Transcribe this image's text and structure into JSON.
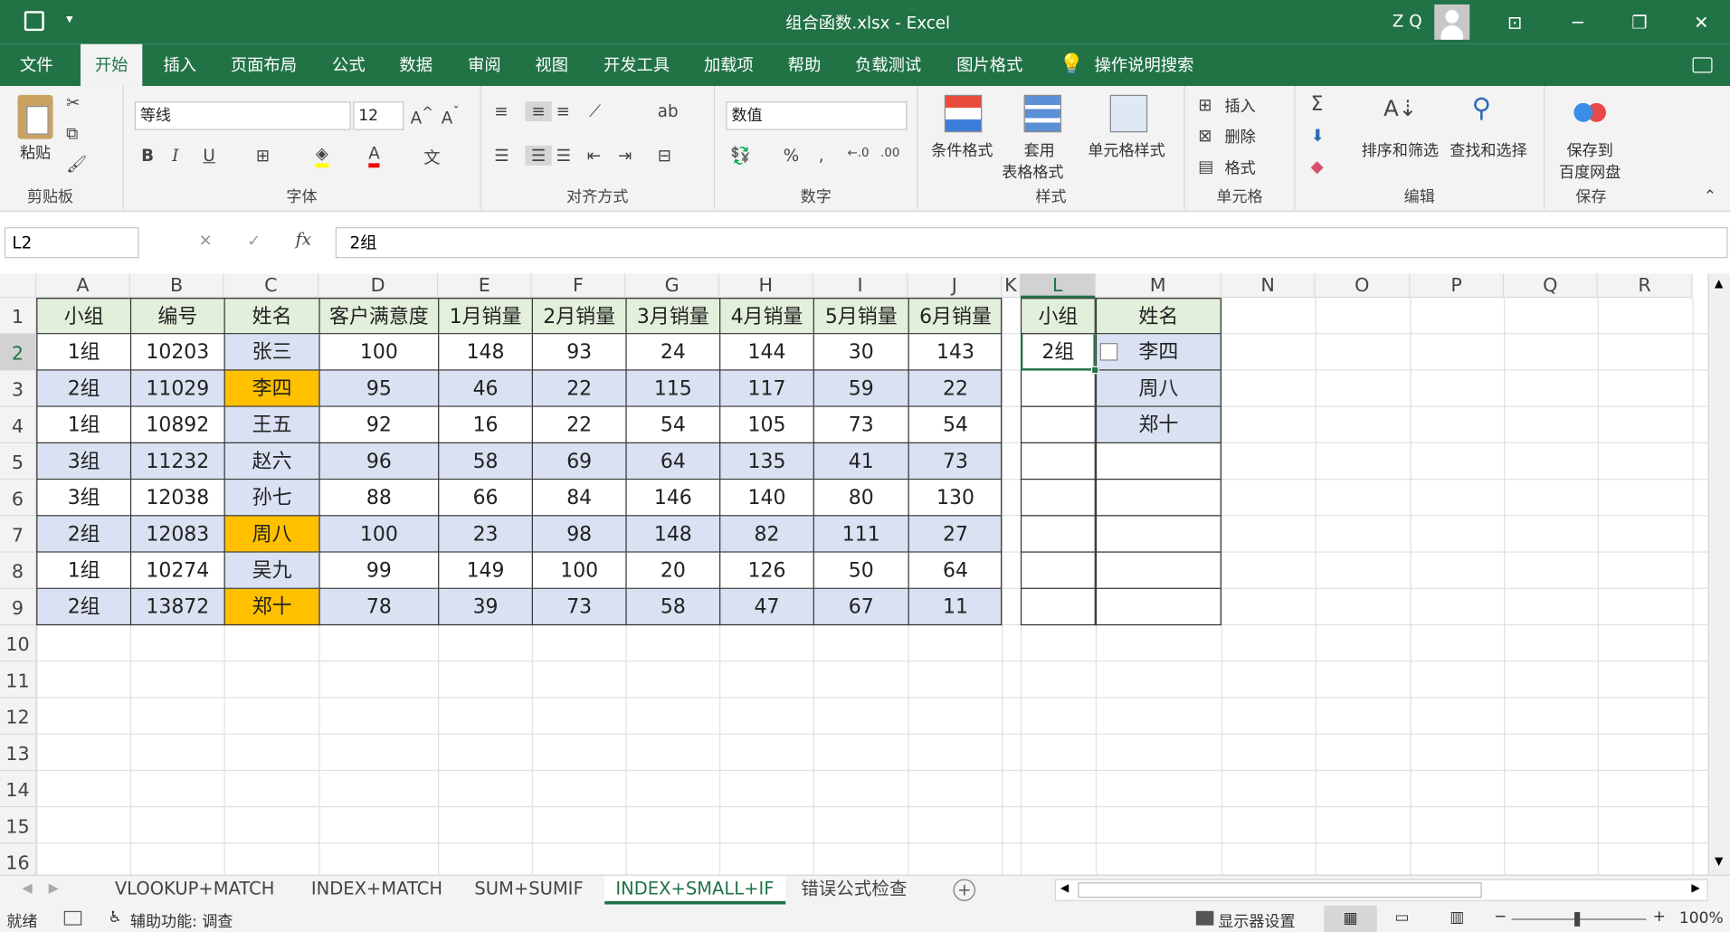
{
  "window": {
    "title": "组合函数.xlsx  -  Excel",
    "user": "Z Q"
  },
  "tabs": [
    "文件",
    "开始",
    "插入",
    "页面布局",
    "公式",
    "数据",
    "审阅",
    "视图",
    "开发工具",
    "加载项",
    "帮助",
    "负载测试",
    "图片格式"
  ],
  "active_tab": "开始",
  "tell_me": "操作说明搜索",
  "ribbon": {
    "clipboard": {
      "paste": "粘贴",
      "label": "剪贴板"
    },
    "font": {
      "name": "等线",
      "size": "12",
      "label": "字体"
    },
    "alignment": {
      "label": "对齐方式"
    },
    "number": {
      "format": "数值",
      "label": "数字"
    },
    "styles": {
      "cond": "条件格式",
      "table1": "套用",
      "table2": "表格格式",
      "cell": "单元格样式",
      "label": "样式"
    },
    "cells": {
      "insert": "插入",
      "delete": "删除",
      "format": "格式",
      "label": "单元格"
    },
    "editing": {
      "sort": "排序和筛选",
      "find": "查找和选择",
      "label": "编辑"
    },
    "save": {
      "b1": "保存到",
      "b2": "百度网盘",
      "label": "保存"
    }
  },
  "formula_bar": {
    "name_box": "L2",
    "formula": "2组"
  },
  "columns": [
    "A",
    "B",
    "C",
    "D",
    "E",
    "F",
    "G",
    "H",
    "I",
    "J",
    "K",
    "L",
    "M",
    "N",
    "O",
    "P",
    "Q",
    "R"
  ],
  "rows": [
    "1",
    "2",
    "3",
    "4",
    "5",
    "6",
    "7",
    "8",
    "9",
    "10",
    "11",
    "12",
    "13",
    "14",
    "15",
    "16"
  ],
  "table": {
    "headers": [
      "小组",
      "编号",
      "姓名",
      "客户满意度",
      "1月销量",
      "2月销量",
      "3月销量",
      "4月销量",
      "5月销量",
      "6月销量"
    ],
    "rows": [
      [
        "1组",
        "10203",
        "张三",
        "100",
        "148",
        "93",
        "24",
        "144",
        "30",
        "143"
      ],
      [
        "2组",
        "11029",
        "李四",
        "95",
        "46",
        "22",
        "115",
        "117",
        "59",
        "22"
      ],
      [
        "1组",
        "10892",
        "王五",
        "92",
        "16",
        "22",
        "54",
        "105",
        "73",
        "54"
      ],
      [
        "3组",
        "11232",
        "赵六",
        "96",
        "58",
        "69",
        "64",
        "135",
        "41",
        "73"
      ],
      [
        "3组",
        "12038",
        "孙七",
        "88",
        "66",
        "84",
        "146",
        "140",
        "80",
        "130"
      ],
      [
        "2组",
        "12083",
        "周八",
        "100",
        "23",
        "98",
        "148",
        "82",
        "111",
        "27"
      ],
      [
        "1组",
        "10274",
        "吴九",
        "99",
        "149",
        "100",
        "20",
        "126",
        "50",
        "64"
      ],
      [
        "2组",
        "13872",
        "郑十",
        "78",
        "39",
        "73",
        "58",
        "47",
        "67",
        "11"
      ]
    ]
  },
  "lookup": {
    "headers": [
      "小组",
      "姓名"
    ],
    "group": "2组",
    "names": [
      "李四",
      "周八",
      "郑十"
    ]
  },
  "sheets": [
    "VLOOKUP+MATCH",
    "INDEX+MATCH",
    "SUM+SUMIF",
    "INDEX+SMALL+IF",
    "错误公式检查"
  ],
  "active_sheet": "INDEX+SMALL+IF",
  "status": {
    "ready": "就绪",
    "accessibility": "辅助功能: 调查",
    "display": "显示器设置",
    "zoom": "100%"
  },
  "colors": {
    "header_green": "#e2efda",
    "row_blue": "#d9e1f2",
    "highlight": "#ffc000",
    "excel_green": "#217346"
  }
}
